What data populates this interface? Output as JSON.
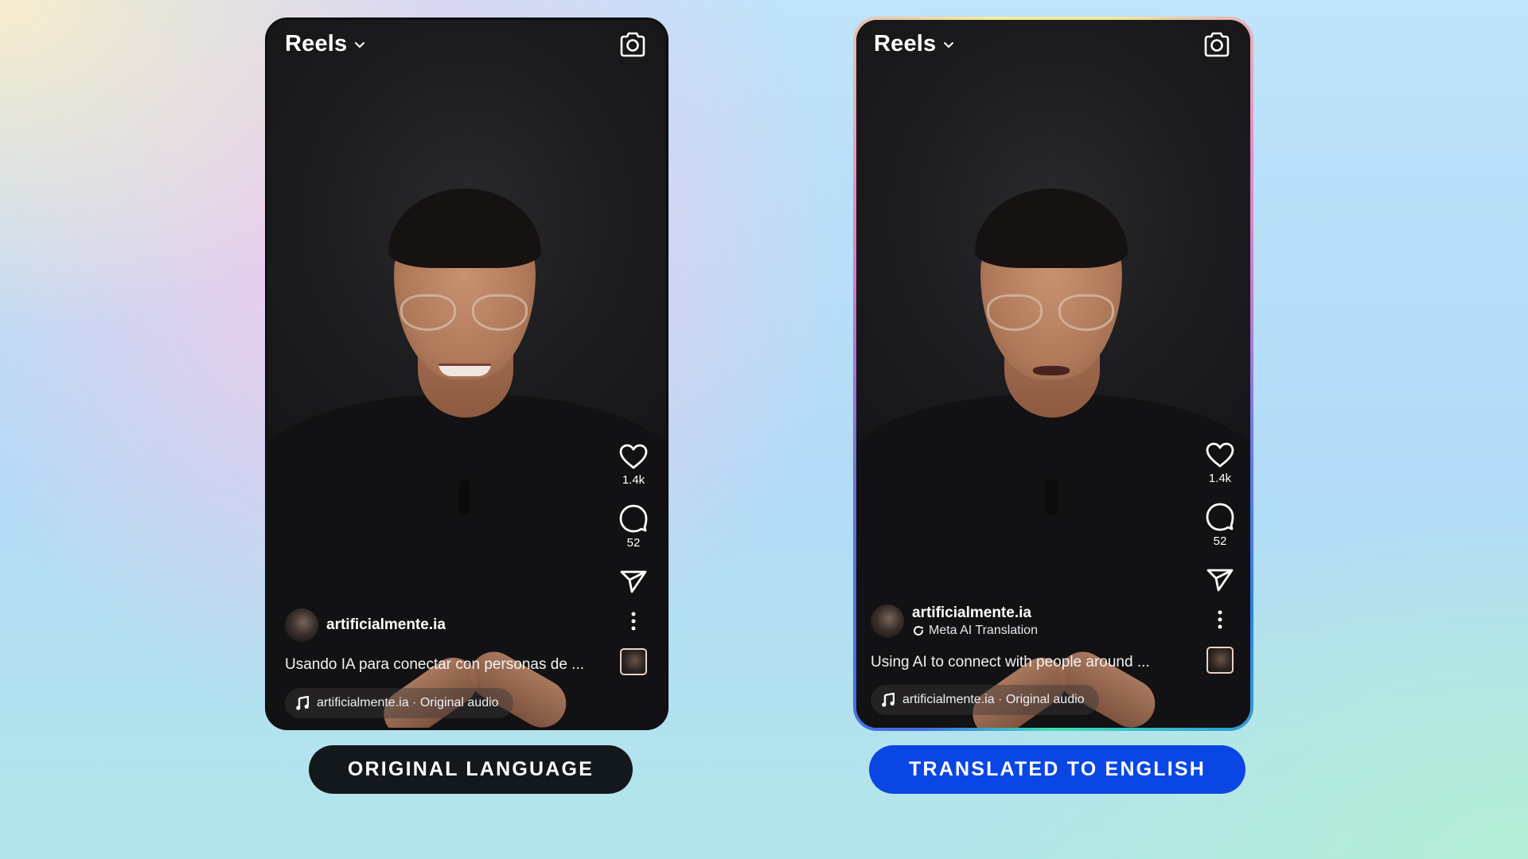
{
  "comparison": {
    "original": {
      "label": "ORIGINAL LANGUAGE",
      "label_color": "#13181d",
      "reel": {
        "title": "Reels",
        "likes": "1.4k",
        "comments": "52",
        "author": "artificialmente.ia",
        "caption": "Usando IA para conectar con personas de ...",
        "audio": "artificialmente.ia · Original audio"
      }
    },
    "translated": {
      "label": "TRANSLATED TO ENGLISH",
      "label_color": "#0a46e4",
      "reel": {
        "title": "Reels",
        "likes": "1.4k",
        "comments": "52",
        "author": "artificialmente.ia",
        "translation_tag": "Meta AI Translation",
        "caption": "Using AI to connect with people around ...",
        "audio": "artificialmente.ia · Original audio"
      }
    }
  },
  "icons": {
    "title_dropdown": "chevron-down-icon",
    "camera": "camera-icon",
    "like": "heart-icon",
    "comment": "comment-bubble-icon",
    "share": "paper-plane-icon",
    "more": "vertical-ellipsis-icon",
    "audio_note": "music-note-icon",
    "translation": "refresh-icon"
  }
}
